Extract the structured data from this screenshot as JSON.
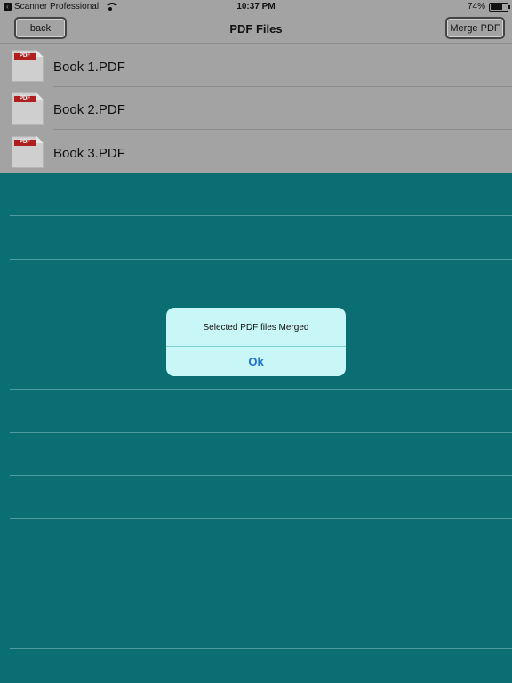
{
  "status_bar": {
    "app_name": "Scanner Professional",
    "time": "10:37 PM",
    "battery": "74%",
    "battery_level": 0.74
  },
  "navbar": {
    "title": "PDF Files",
    "back_label": "back",
    "merge_label": "Merge PDF"
  },
  "files": [
    {
      "name": "Book 1.PDF",
      "icon_label": "PDF"
    },
    {
      "name": "Book 2.PDF",
      "icon_label": "PDF"
    },
    {
      "name": "Book 3.PDF",
      "icon_label": "PDF"
    }
  ],
  "alert": {
    "message": "Selected PDF files Merged",
    "ok_label": "Ok"
  },
  "colors": {
    "overlay_teal": "#0a6e73",
    "dimmed_gray": "#a3a3a3",
    "alert_bg": "#c9f7f7",
    "alert_button": "#1f6fd6"
  }
}
